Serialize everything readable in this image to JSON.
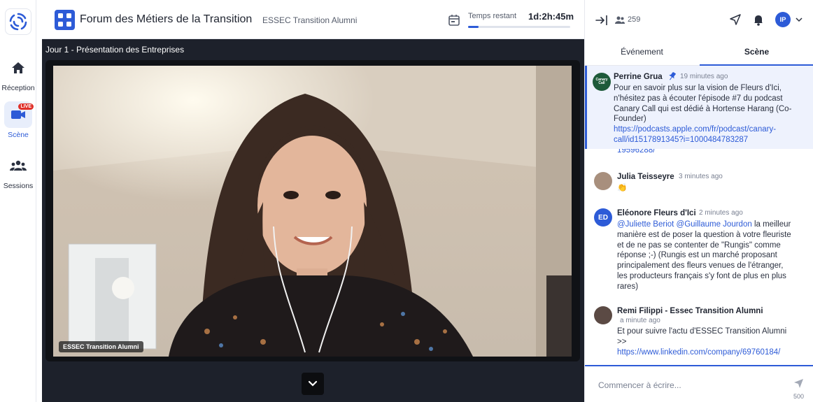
{
  "nav": {
    "items": [
      {
        "label": "Réception",
        "icon": "home-icon"
      },
      {
        "label": "Scène",
        "icon": "video-camera-icon",
        "badge": "LIVE"
      },
      {
        "label": "Sessions",
        "icon": "people-group-icon"
      }
    ]
  },
  "header": {
    "title": "Forum des Métiers de la Transition",
    "organizer": "ESSEC Transition Alumni",
    "time_label": "Temps restant",
    "time_value": "1d:2h:45m",
    "time_progress": 0.1
  },
  "stage": {
    "title": "Jour 1 - Présentation des Entreprises",
    "video_tag": "ESSEC Transition Alumni"
  },
  "panel": {
    "attendees": "259",
    "user_initials": "IP",
    "tabs": [
      "Événement",
      "Scène"
    ],
    "active_tab": "Scène",
    "composer_placeholder": "Commencer à écrire...",
    "char_count": "500"
  },
  "chat": {
    "pinned": {
      "author": "Perrine Grua",
      "time": "19 minutes ago",
      "text_lines": [
        "Pour en savoir plus sur la vision de Fleurs d'Ici,",
        "n'hésitez pas à écouter l'épisode #7 du podcast",
        "Canary Call qui est dédié à Hortense Harang (Co-",
        "Founder)"
      ],
      "link_lines": [
        "https://podcasts.apple.com/fr/podcast/canary-",
        "call/id1517891345?i=1000484783287"
      ],
      "avatar_text": "Canary Call"
    },
    "overflow_fragment": "19596288/",
    "messages": [
      {
        "author": "Julia Teisseyre",
        "time": "3 minutes ago",
        "text": "👏"
      },
      {
        "author": "Eléonore Fleurs d'Ici",
        "time": "2 minutes ago",
        "initials": "ED",
        "mentions": "@Juliette Beriot @Guillaume Jourdon",
        "mention_tail": " la meilleur",
        "lines": [
          "manière est de poser la question à votre fleuriste",
          "et de ne pas se contenter de \"Rungis\" comme",
          "réponse ;-) (Rungis est un marché proposant",
          "principalement des fleurs venues de l'étranger,",
          "les producteurs français s'y font de plus en plus",
          "rares)"
        ]
      },
      {
        "author": "Remi Filippi - Essec Transition Alumni",
        "time": "a minute ago",
        "lines": [
          "Et pour suivre l'actu d'ESSEC Transition Alumni",
          ">>"
        ],
        "link": "https://www.linkedin.com/company/69760184/"
      }
    ]
  },
  "colors": {
    "accent": "#2d5bd7",
    "live": "#e0312a",
    "stage_bg": "#1d212b"
  }
}
